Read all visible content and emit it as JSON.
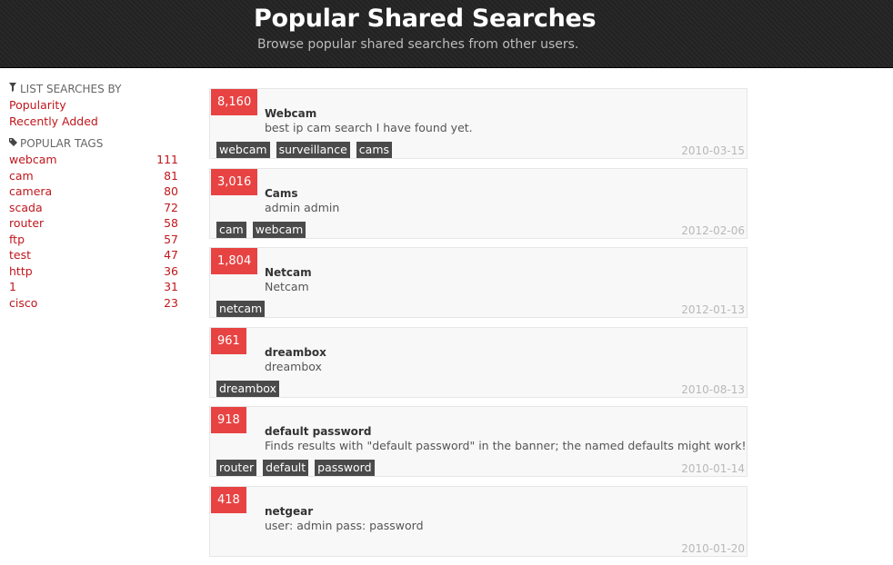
{
  "header": {
    "title": "Popular Shared Searches",
    "subtitle": "Browse popular shared searches from other users."
  },
  "sidebar": {
    "list_title": "LIST SEARCHES BY",
    "list_icon": "filter-icon",
    "sort_links": [
      "Popularity",
      "Recently Added"
    ],
    "tags_title": "POPULAR TAGS",
    "tags_icon": "tag-icon",
    "tags": [
      {
        "name": "webcam",
        "count": "111"
      },
      {
        "name": "cam",
        "count": "81"
      },
      {
        "name": "camera",
        "count": "80"
      },
      {
        "name": "scada",
        "count": "72"
      },
      {
        "name": "router",
        "count": "58"
      },
      {
        "name": "ftp",
        "count": "57"
      },
      {
        "name": "test",
        "count": "47"
      },
      {
        "name": "http",
        "count": "36"
      },
      {
        "name": "1",
        "count": "31"
      },
      {
        "name": "cisco",
        "count": "23"
      }
    ]
  },
  "searches": [
    {
      "votes": "8,160",
      "title": "Webcam",
      "description": "best ip cam search I have found yet.",
      "tags": [
        "webcam",
        "surveillance",
        "cams"
      ],
      "date": "2010-03-15"
    },
    {
      "votes": "3,016",
      "title": "Cams",
      "description": "admin admin",
      "tags": [
        "cam",
        "webcam"
      ],
      "date": "2012-02-06"
    },
    {
      "votes": "1,804",
      "title": "Netcam",
      "description": "Netcam",
      "tags": [
        "netcam"
      ],
      "date": "2012-01-13"
    },
    {
      "votes": "961",
      "title": "dreambox",
      "description": "dreambox",
      "tags": [
        "dreambox"
      ],
      "date": "2010-08-13"
    },
    {
      "votes": "918",
      "title": "default password",
      "description": "Finds results with \"default password\" in the banner; the named defaults might work!",
      "tags": [
        "router",
        "default",
        "password"
      ],
      "date": "2010-01-14"
    },
    {
      "votes": "418",
      "title": "netgear",
      "description": "user: admin pass: password",
      "tags": [],
      "date": "2010-01-20"
    }
  ],
  "colors": {
    "accent": "#e84343",
    "link": "#c0161c",
    "header_bg": "#222222",
    "tag_bg": "#4a4a4a"
  }
}
